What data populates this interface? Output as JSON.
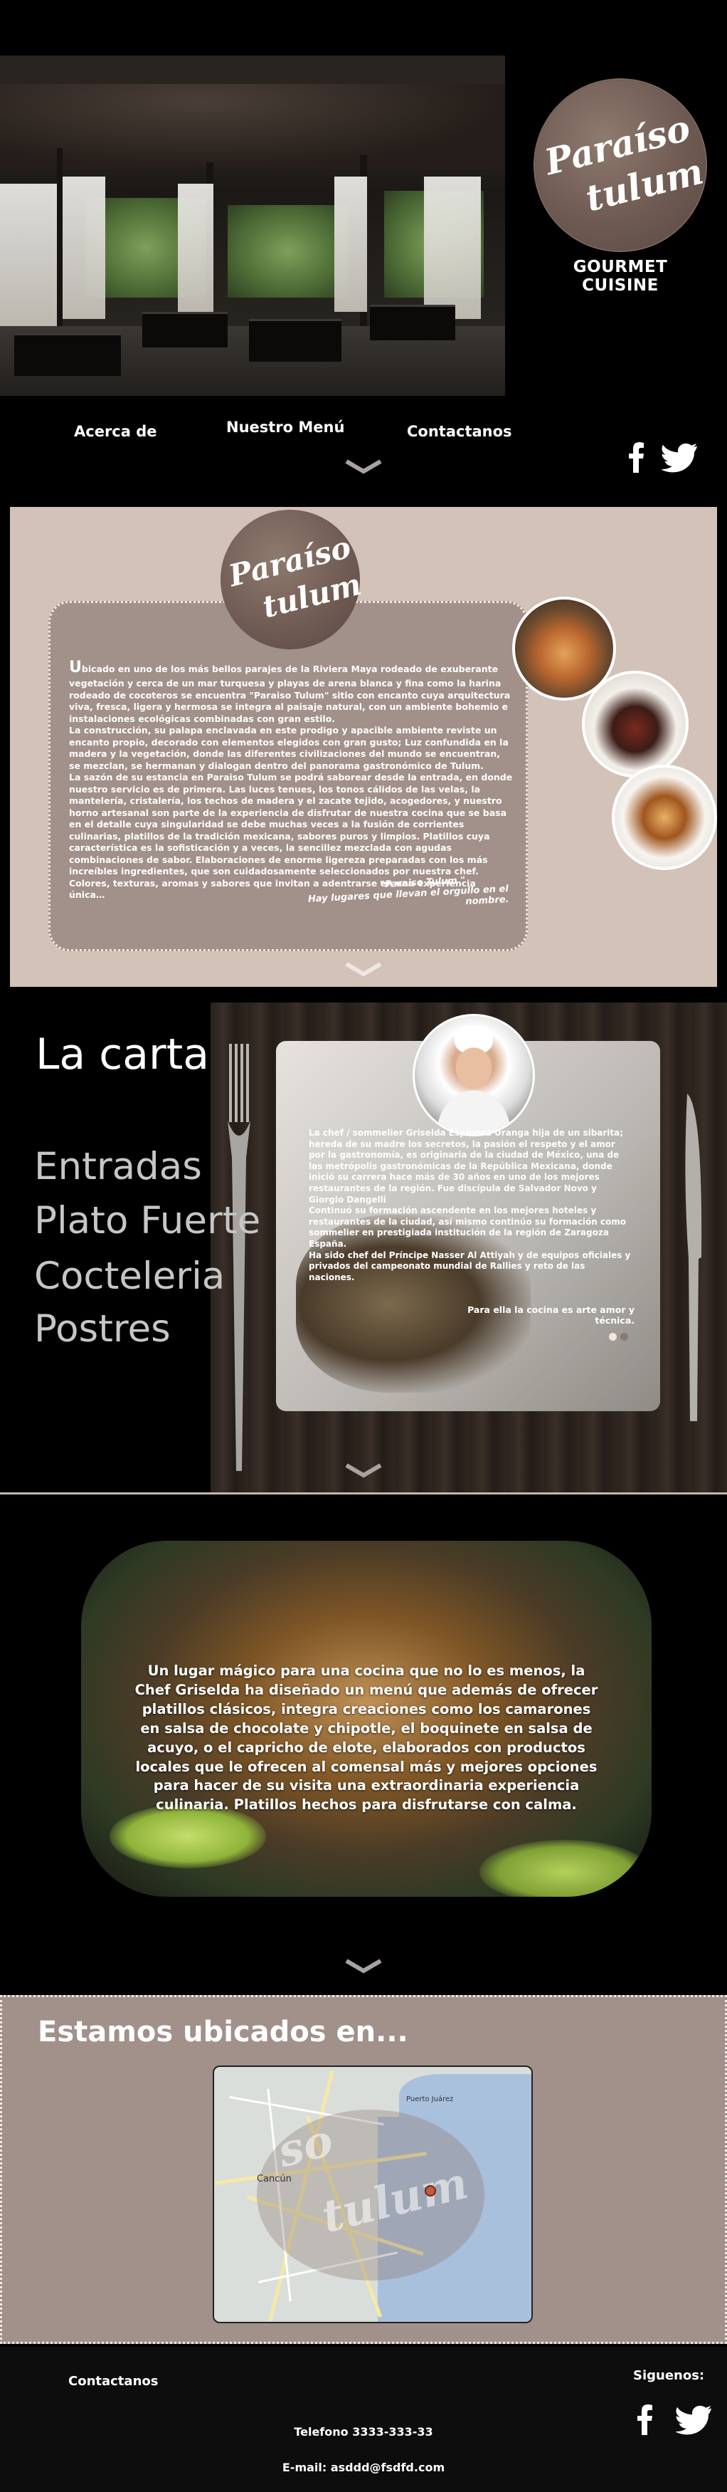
{
  "brand": {
    "logo_line1": "Paraíso",
    "logo_line2": "tulum",
    "tagline": "GOURMET CUISINE"
  },
  "nav": {
    "about": "Acerca de",
    "menu": "Nuestro Menú",
    "contact": "Contactanos"
  },
  "social": {
    "facebook_icon": "facebook-icon",
    "twitter_icon": "twitter-icon"
  },
  "about": {
    "drop_cap": "U",
    "paragraphs": [
      "bicado en uno de los más bellos parajes de la Riviera Maya rodeado de exuberante vegetación y cerca de un mar turquesa y playas de arena blanca y fina como la harina rodeado de cocoteros se encuentra \"Paraiso Tulum\" sitio con encanto cuya arquitectura viva, fresca, ligera y hermosa se integra al paisaje natural, con un ambiente bohemio e instalaciones ecológicas combinadas con gran estilo.",
      "La construcción, su palapa enclavada en este prodigo y apacible ambiente reviste un encanto propio, decorado con elementos elegidos con gran gusto; Luz confundida en la madera y la vegetación, donde las diferentes civilizaciones del mundo se encuentran, se mezclan, se hermanan y dialogan dentro del panorama gastronómico de Tulum.",
      "La sazón de su estancia en Paraiso Tulum se podrá saborear desde la entrada, en donde nuestro servicio es de primera. Las luces tenues, los tonos cálidos de las velas, la mantelería, cristalería, los techos de madera y el zacate tejido, acogedores, y nuestro horno artesanal son parte de la experiencia de disfrutar de nuestra cocina que se basa en el detalle cuya singularidad se debe muchas veces a la fusión de corrientes culinarias, platillos de la tradición mexicana, sabores puros y limpios. Platillos cuya característica es la sofisticación y a veces, la sencillez mezclada con agudas combinaciones de sabor. Elaboraciones de enorme ligereza preparadas con los más increíbles ingredientes, que son cuidadosamente seleccionados por nuestra chef. Colores, texturas, aromas y sabores que invitan a adentrarse en una experiencia única…"
    ],
    "quote_line1": "\"Paraiso Tulum \"",
    "quote_line2": "Hay lugares que llevan el orgullo en el nombre."
  },
  "carta": {
    "title": "La carta",
    "items": [
      "Entradas",
      "Plato Fuerte",
      "Cocteleria",
      "Postres"
    ],
    "chef_text": [
      "La chef / sommelier  Griselda Espinosa Uranga hija de un sibarita; hereda de su madre los secretos, la pasión el respeto y el amor por la gastronomía, es originaria de la ciudad de México, una de las metrópolis gastronómicas de la República Mexicana, donde inició su carrera hace más de 30 años en uno de los mejores restaurantes de la región. Fue discípula de Salvador Novo y Giorgio Dangelli",
      "Continuó su formación ascendente en los mejores hoteles y restaurantes de la ciudad, así mismo continúo su formación como sommelier en prestigiada institución de la región de Zaragoza España.",
      "Ha sido chef del Príncipe Nasser Al Attiyah y de equipos oficiales y privados del campeonato mundial de Rallies y reto de las naciones."
    ],
    "motto": "Para ella la cocina es arte amor y técnica.",
    "colors": {
      "dot_active": "#f2e6d8",
      "dot_inactive": "#8a7a72"
    }
  },
  "promo": {
    "text": "Un lugar mágico para una cocina que no lo es menos, la Chef Griselda ha diseñado un menú que además de ofrecer platillos clásicos, integra creaciones como los camarones en salsa de chocolate y chipotle,  el boquinete en salsa de acuyo, o el capricho de elote, elaborados  con productos locales que le ofrecen al comensal más y mejores opciones para hacer de su visita una extraordinaria experiencia culinaria. Platillos hechos para disfrutarse con calma."
  },
  "location": {
    "title": "Estamos ubicados en...",
    "map_labels": [
      "Cancún",
      "Puerto Juárez"
    ],
    "map_watermark_line1": "so",
    "map_watermark_line2": "tulum"
  },
  "footer": {
    "contact": "Contactanos",
    "follow": "Siguenos:",
    "phone": "Telefono 3333-333-33",
    "email": "E-mail: asddd@fsdfd.com"
  },
  "colors": {
    "accent_taupe": "#a1918a",
    "card_beige": "#d3c2b8",
    "logo_brown": "#6e5a52"
  }
}
